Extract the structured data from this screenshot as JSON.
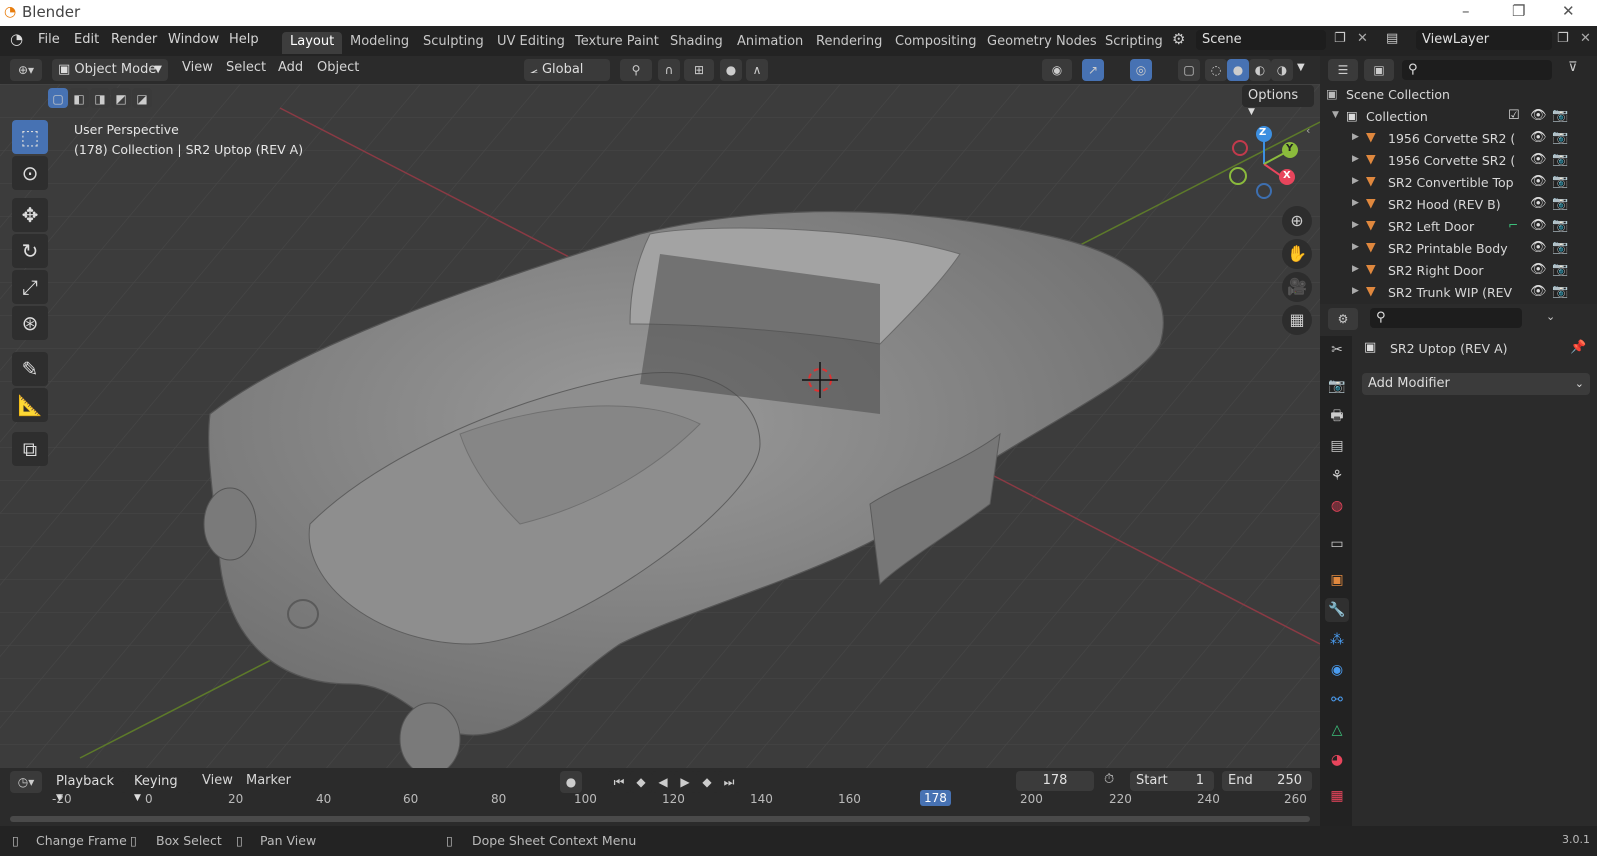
{
  "window": {
    "title": "Blender",
    "controls": [
      "–",
      "❐",
      "✕"
    ]
  },
  "menu": {
    "items": [
      "File",
      "Edit",
      "Render",
      "Window",
      "Help"
    ]
  },
  "workspaces": [
    "Layout",
    "Modeling",
    "Sculpting",
    "UV Editing",
    "Texture Paint",
    "Shading",
    "Animation",
    "Rendering",
    "Compositing",
    "Geometry Nodes",
    "Scripting"
  ],
  "scene": {
    "name": "Scene",
    "view_layer": "ViewLayer"
  },
  "viewport_header": {
    "mode": "Object Mode",
    "menus": [
      "View",
      "Select",
      "Add",
      "Object"
    ],
    "orientation": "Global",
    "options_label": "Options"
  },
  "viewport": {
    "perspective": "User Perspective",
    "active_info": "(178) Collection | SR2 Uptop (REV A)",
    "axes": {
      "x": "X",
      "y": "Y",
      "z": "Z"
    }
  },
  "outliner": {
    "scene_collection": "Scene Collection",
    "collection": "Collection",
    "items": [
      "1956 Corvette SR2 (",
      "1956 Corvette SR2 (",
      "SR2 Convertible Top",
      "SR2 Hood (REV B)",
      "SR2 Left Door",
      "SR2 Printable Body",
      "SR2 Right Door",
      "SR2 Trunk WIP (REV"
    ]
  },
  "properties": {
    "object_name": "SR2 Uptop (REV A)",
    "add_modifier": "Add Modifier"
  },
  "timeline": {
    "menus": [
      "Playback",
      "Keying",
      "View",
      "Marker"
    ],
    "current_frame": "178",
    "start_label": "Start",
    "start": "1",
    "end_label": "End",
    "end": "250",
    "ticks": [
      "-20",
      "0",
      "20",
      "40",
      "60",
      "80",
      "100",
      "120",
      "140",
      "160",
      "178",
      "200",
      "220",
      "240",
      "260"
    ]
  },
  "statusbar": {
    "change_frame": "Change Frame",
    "box_select": "Box Select",
    "pan_view": "Pan View",
    "context_menu": "Dope Sheet Context Menu",
    "version": "3.0.1"
  },
  "colors": {
    "accent": "#4772b3",
    "x_axis": "#e8455c",
    "y_axis": "#8bbb3c",
    "z_axis": "#3d8fe0",
    "object_icon": "#e0883e"
  }
}
